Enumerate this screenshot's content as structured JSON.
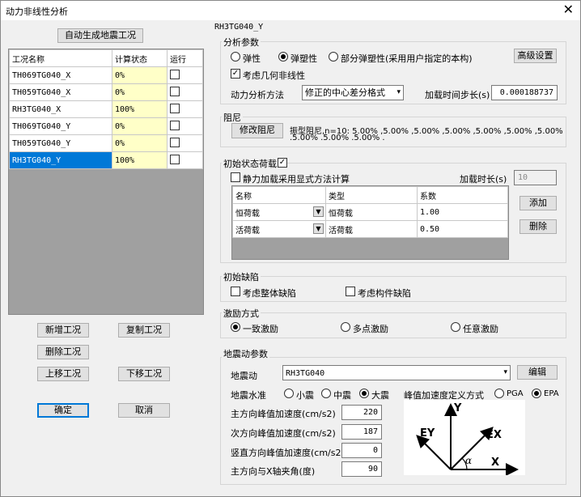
{
  "window": {
    "title": "动力非线性分析",
    "close_icon": "close-icon"
  },
  "left": {
    "auto_generate_btn": "自动生成地震工况",
    "table": {
      "headers": [
        "工况名称",
        "计算状态",
        "运行"
      ],
      "rows": [
        {
          "name": "TH069TG040_X",
          "status": "0%",
          "selected": false
        },
        {
          "name": "TH059TG040_X",
          "status": "0%",
          "selected": false
        },
        {
          "name": "RH3TG040_X",
          "status": "100%",
          "selected": false
        },
        {
          "name": "TH069TG040_Y",
          "status": "0%",
          "selected": false
        },
        {
          "name": "TH059TG040_Y",
          "status": "0%",
          "selected": false
        },
        {
          "name": "RH3TG040_Y",
          "status": "100%",
          "selected": true
        }
      ]
    },
    "buttons": {
      "add": "新增工况",
      "copy": "复制工况",
      "delete": "删除工况",
      "up": "上移工况",
      "down": "下移工况",
      "ok": "确定",
      "cancel": "取消"
    }
  },
  "right": {
    "case_title": "RH3TG040_Y",
    "analysis": {
      "group": "分析参数",
      "opt_elastic": "弹性",
      "opt_plastic": "弹塑性",
      "opt_partial": "部分弹塑性(采用用户指定的本构)",
      "selected": "plastic",
      "advanced_btn": "高级设置",
      "geom_nonlinear": "考虑几何非线性",
      "geom_checked": true,
      "method_label": "动力分析方法",
      "method_value": "修正的中心差分格式",
      "step_label": "加载时间步长(s)",
      "step_value": "0.000188737"
    },
    "damping": {
      "group": "阻尼",
      "modify_btn": "修改阻尼",
      "text1": "振型阻尼,n=10: 5.00% ,5.00% ,5.00% ,5.00% ,5.00% ,5.00% ,5.00%",
      "text2": ".5.00% .5.00% .5.00% ."
    },
    "initial_load": {
      "group": "初始状态荷载",
      "group_checked": true,
      "static_label": "静力加载采用显式方法计算",
      "static_checked": false,
      "duration_label": "加载时长(s)",
      "duration_value": "10",
      "headers": [
        "名称",
        "类型",
        "系数"
      ],
      "rows": [
        {
          "name": "恒荷载",
          "type": "恒荷载",
          "coef": "1.00"
        },
        {
          "name": "活荷载",
          "type": "活荷载",
          "coef": "0.50"
        }
      ],
      "add_btn": "添加",
      "delete_btn": "删除"
    },
    "defect": {
      "group": "初始缺陷",
      "whole": "考虑整体缺陷",
      "member": "考虑构件缺陷"
    },
    "excitation": {
      "group": "激励方式",
      "opt1": "一致激励",
      "opt2": "多点激励",
      "opt3": "任意激励",
      "selected": "opt1"
    },
    "ground": {
      "group": "地震动参数",
      "motion_label": "地震动",
      "motion_value": "RH3TG040",
      "edit_btn": "编辑",
      "level_label": "地震水准",
      "lvl_small": "小震",
      "lvl_mid": "中震",
      "lvl_big": "大震",
      "level_selected": "big",
      "peak_def_label": "峰值加速度定义方式",
      "pga": "PGA",
      "epa": "EPA",
      "peak_selected": "epa",
      "main_label": "主方向峰值加速度(cm/s2)",
      "main_value": "220",
      "second_label": "次方向峰值加速度(cm/s2)",
      "second_value": "187",
      "vert_label": "竖直方向峰值加速度(cm/s2)",
      "vert_value": "0",
      "angle_label": "主方向与X轴夹角(度)",
      "angle_value": "90",
      "diagram": {
        "y": "Y",
        "ey": "EY",
        "ex": "EX",
        "x": "X",
        "alpha": "α"
      }
    }
  }
}
